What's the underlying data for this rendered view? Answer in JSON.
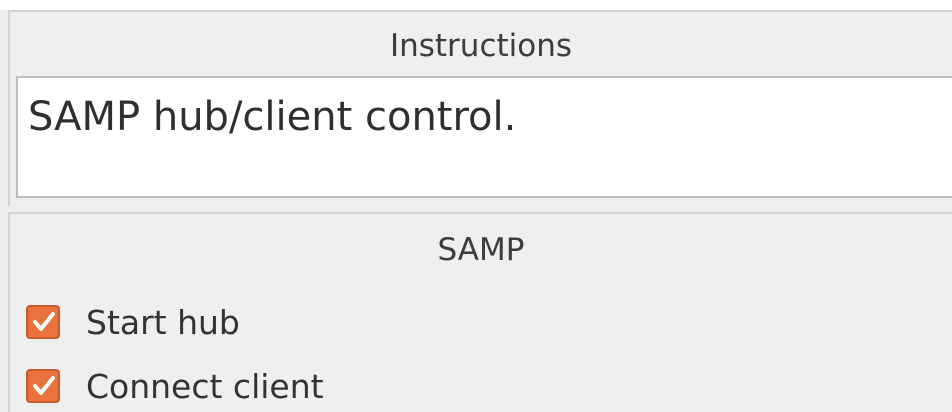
{
  "instructions": {
    "title": "Instructions",
    "text": "SAMP hub/client control."
  },
  "samp": {
    "title": "SAMP",
    "options": [
      {
        "label": "Start hub",
        "checked": true
      },
      {
        "label": "Connect client",
        "checked": true
      }
    ]
  },
  "colors": {
    "accent": "#e9733f",
    "panel": "#efefef",
    "text": "#333333"
  }
}
